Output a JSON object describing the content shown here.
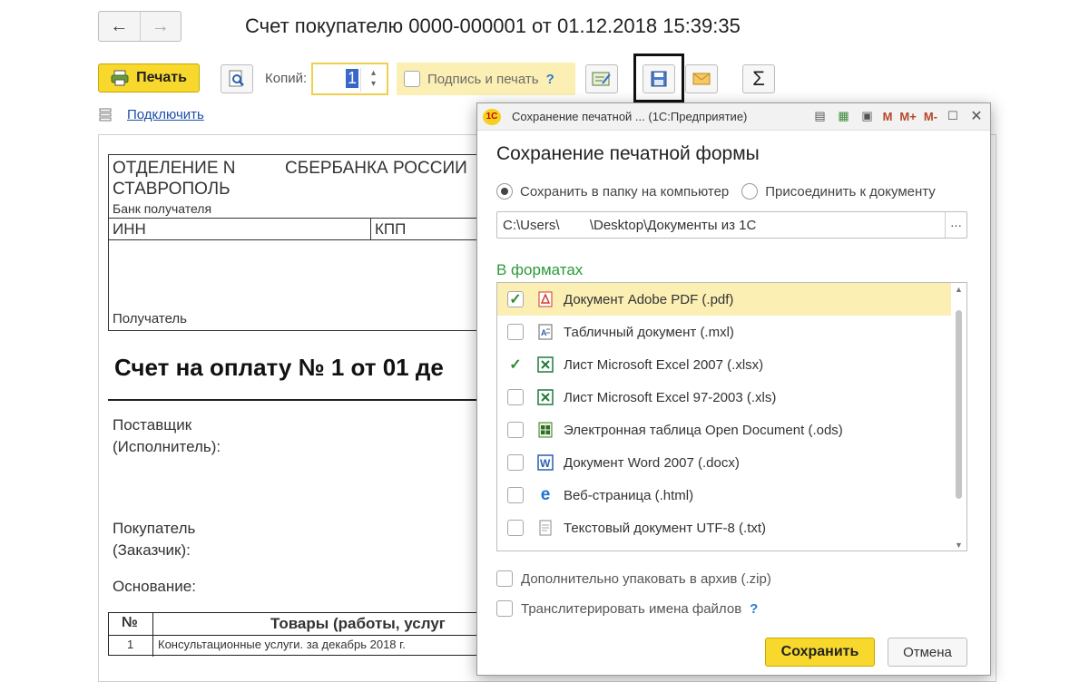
{
  "header": {
    "back_icon": "←",
    "forward_icon": "→",
    "title": "Счет покупателю 0000-000001 от 01.12.2018 15:39:35"
  },
  "toolbar": {
    "print_label": "Печать",
    "copies_label": "Копий:",
    "copies_value": "1",
    "sign_label": "Подпись и печать",
    "help_mark": "?",
    "sigma": "Σ"
  },
  "connect": {
    "label": "Подключить"
  },
  "document": {
    "bank_line1_left": "ОТДЕЛЕНИЕ N",
    "bank_line1_right": "СБЕРБАНКА РОССИИ",
    "bank_line2": "СТАВРОПОЛЬ",
    "bank_caption": "Банк получателя",
    "inn": "ИНН",
    "kpp": "КПП",
    "recipient": "Получатель",
    "invoice_title": "Счет на оплату № 1 от 01 де",
    "supplier_1": "Поставщик",
    "supplier_2": "(Исполнитель):",
    "buyer_1": "Покупатель",
    "buyer_2": "(Заказчик):",
    "basis": "Основание:",
    "col_num": "№",
    "col_goods": "Товары (работы, услуг",
    "row_num": "1",
    "row_goods": "Консультационные услуги. за декабрь 2018 г."
  },
  "dialog": {
    "window_title": "Сохранение печатной ...  (1С:Предприятие)",
    "title_icons": [
      "M",
      "M+",
      "M-"
    ],
    "heading": "Сохранение печатной формы",
    "radio_save": "Сохранить в папку на компьютер",
    "radio_attach": "Присоединить к документу",
    "path": "C:\\Users\\        \\Desktop\\Документы из 1С",
    "path_button": "...",
    "formats_label": "В форматах",
    "formats": [
      {
        "label": "Документ Adobe PDF (.pdf)",
        "checked": true,
        "icon": "pdf-icon"
      },
      {
        "label": "Табличный документ (.mxl)",
        "checked": false,
        "icon": "mxl-icon"
      },
      {
        "label": "Лист Microsoft Excel 2007 (.xlsx)",
        "checked": true,
        "icon": "excel-icon"
      },
      {
        "label": "Лист Microsoft Excel 97-2003 (.xls)",
        "checked": false,
        "icon": "excel-icon"
      },
      {
        "label": "Электронная таблица Open Document (.ods)",
        "checked": false,
        "icon": "ods-icon"
      },
      {
        "label": "Документ Word 2007 (.docx)",
        "checked": false,
        "icon": "word-icon"
      },
      {
        "label": "Веб-страница (.html)",
        "checked": false,
        "icon": "edge-icon"
      },
      {
        "label": "Текстовый документ UTF-8 (.txt)",
        "checked": false,
        "icon": "txt-icon"
      }
    ],
    "zip_label": "Дополнительно упаковать в архив (.zip)",
    "translit_label": "Транслитерировать имена файлов",
    "help_mark": "?",
    "save_label": "Сохранить",
    "cancel_label": "Отмена"
  },
  "colors": {
    "accent_yellow": "#f8d82d",
    "formats_green": "#2b9a3a",
    "link_blue": "#1c4fa5"
  }
}
